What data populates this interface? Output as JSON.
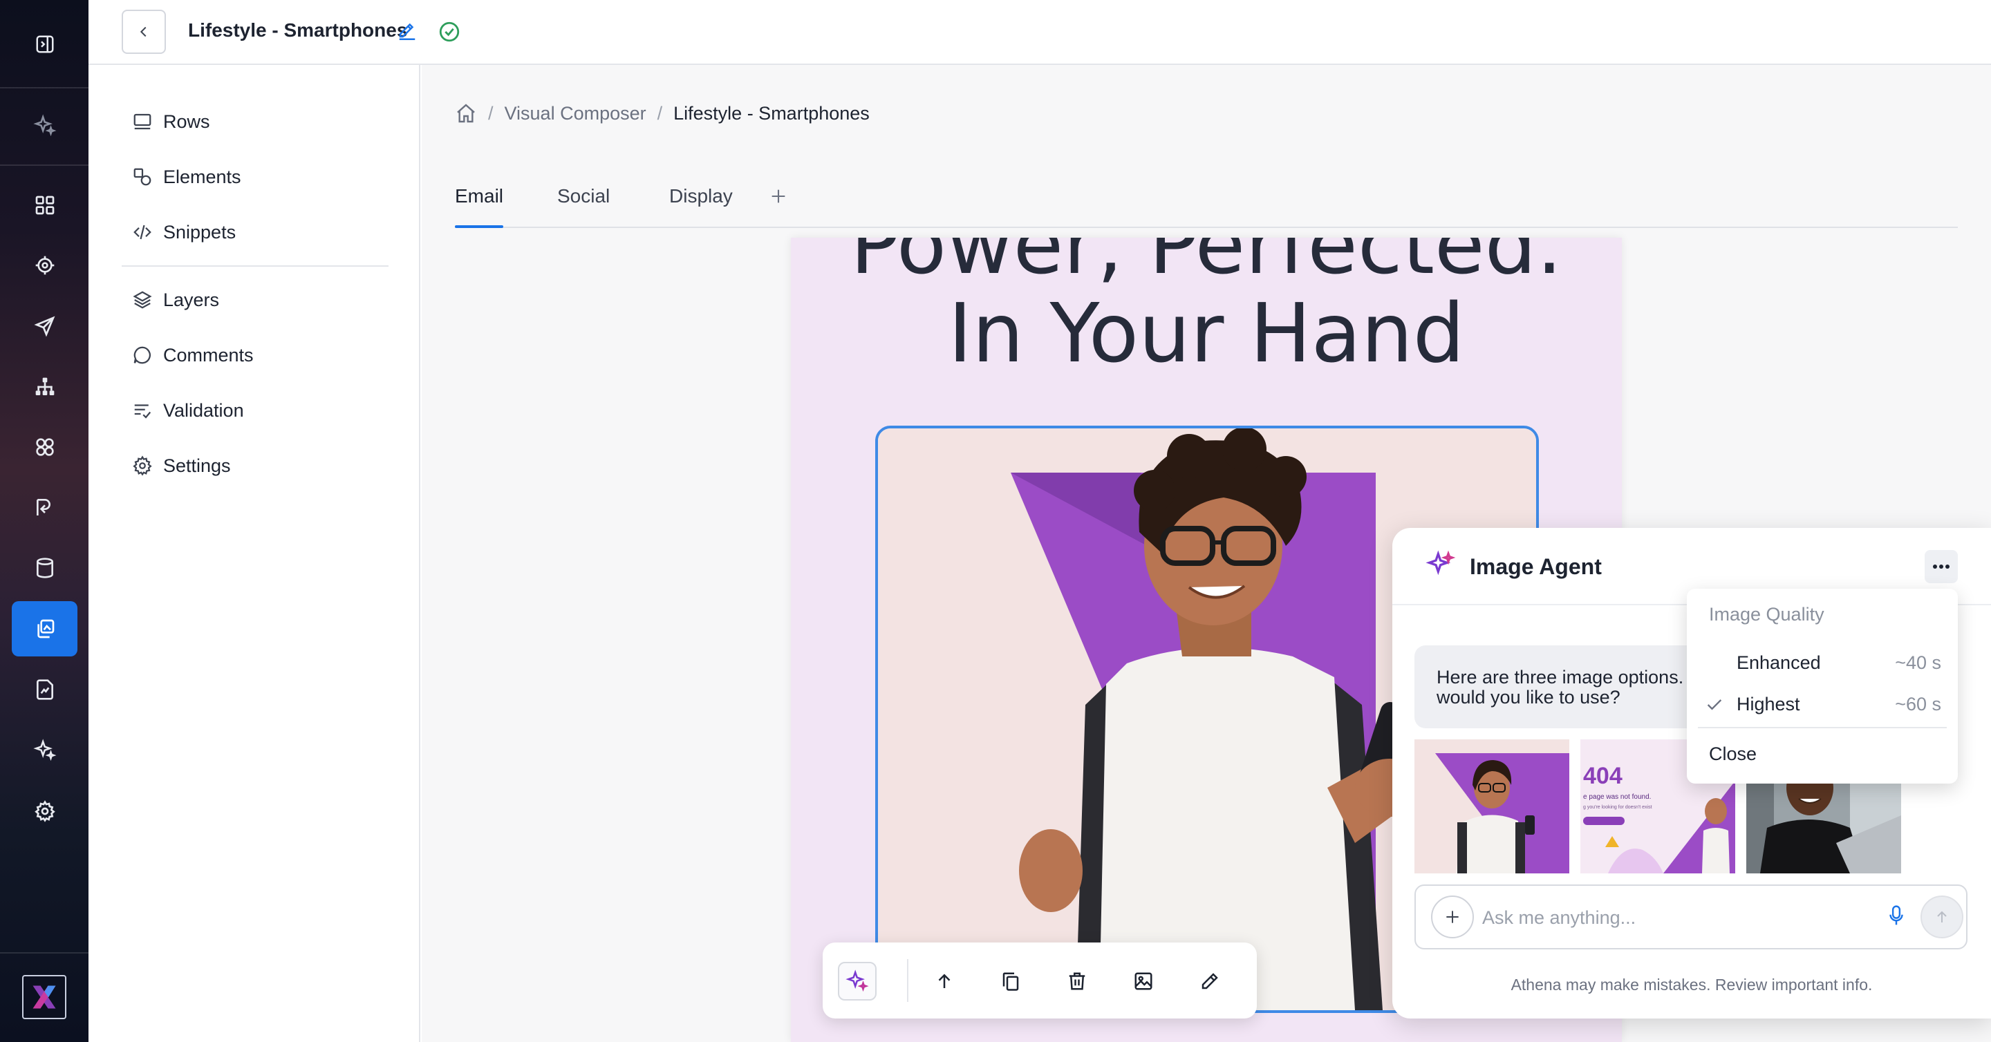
{
  "header": {
    "title": "Lifestyle - Smartphones"
  },
  "panel": {
    "items": [
      {
        "label": "Rows",
        "icon": "rows-icon"
      },
      {
        "label": "Elements",
        "icon": "elements-icon"
      },
      {
        "label": "Snippets",
        "icon": "code-icon"
      },
      {
        "label": "Layers",
        "icon": "layers-icon"
      },
      {
        "label": "Comments",
        "icon": "comment-icon"
      },
      {
        "label": "Validation",
        "icon": "validation-icon"
      },
      {
        "label": "Settings",
        "icon": "gear-icon"
      }
    ]
  },
  "breadcrumb": {
    "sep": "/",
    "items": [
      "Visual Composer",
      "Lifestyle - Smartphones"
    ]
  },
  "tabs": [
    "Email",
    "Social",
    "Display"
  ],
  "email": {
    "headline_line1": "Power, Perfected.",
    "headline_line2": "In Your Hand"
  },
  "agent": {
    "title": "Image Agent",
    "message": "Here are three image options. Which would you like to use?",
    "input_placeholder": "Ask me anything...",
    "disclaimer": "Athena may make mistakes. Review important info.",
    "thumb2_text_big": "404",
    "thumb2_text_small": "e page was not found.",
    "thumb2_text_tiny": "g you're looking for doesn't exist"
  },
  "quality_menu": {
    "header": "Image Quality",
    "options": [
      {
        "label": "Enhanced",
        "time": "~40 s",
        "selected": false
      },
      {
        "label": "Highest",
        "time": "~60 s",
        "selected": true
      }
    ],
    "close": "Close"
  },
  "colors": {
    "accent": "#1a73e8",
    "success": "#2e9e5b",
    "email_bg": "#f2e5f5",
    "brand_purple": "#8a3fb8"
  }
}
